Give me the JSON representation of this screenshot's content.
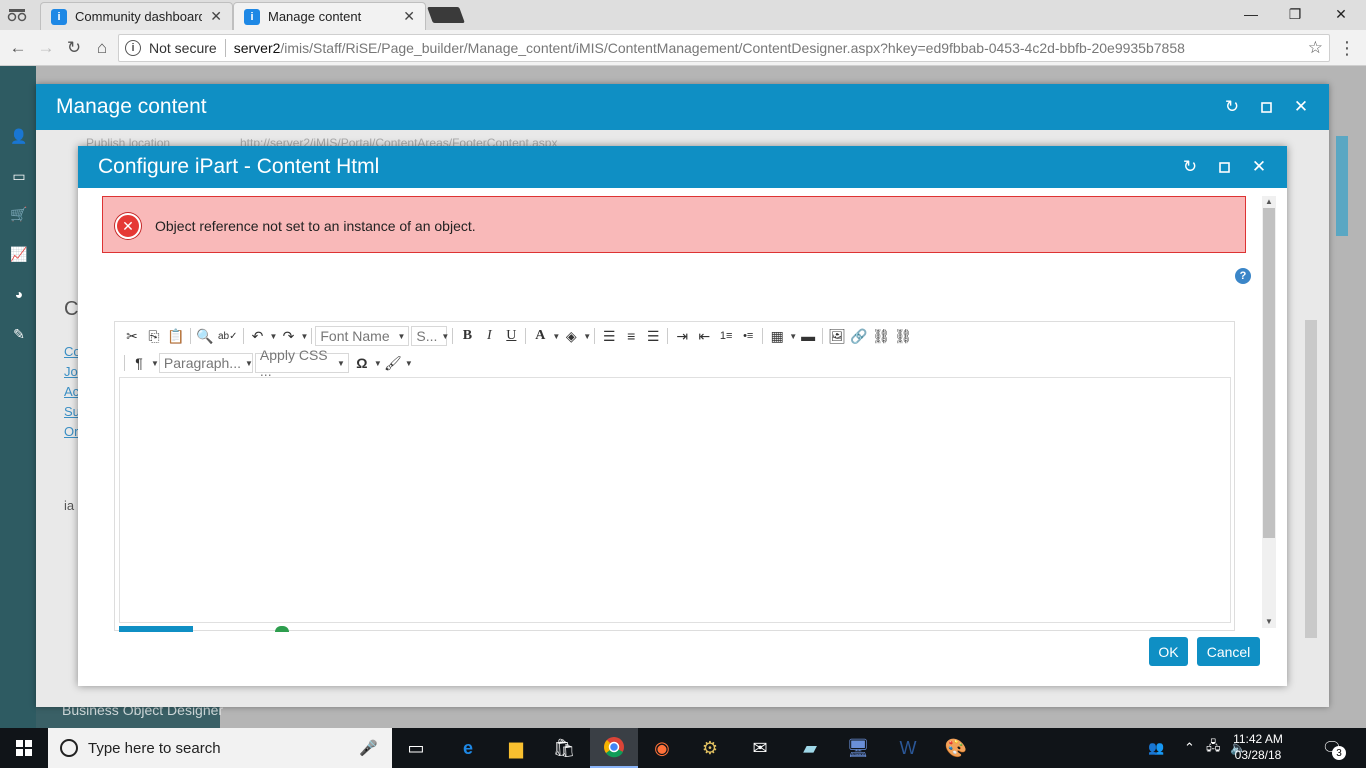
{
  "browser": {
    "tabs": [
      {
        "title": "Community dashboard",
        "active": false
      },
      {
        "title": "Manage content",
        "active": true
      }
    ],
    "address": {
      "security_label": "Not secure",
      "host": "server2",
      "path": "/imis/Staff/RiSE/Page_builder/Manage_content/iMIS/ContentManagement/ContentDesigner.aspx?hkey=ed9fbbab-0453-4c2d-bbfb-20e9935b7858"
    },
    "window_controls": {
      "minimize": "—",
      "maximize": "❐",
      "close": "✕"
    }
  },
  "background": {
    "publish_label": "Publish location",
    "publish_value": "http://server2/iMIS/Portal/ContentAreas/FooterContent.aspx",
    "side_letter": "C",
    "links": [
      "Co",
      "Jo",
      "Ac",
      "Su",
      "Or"
    ],
    "fragment": "ia",
    "bottom_text": "Business Object Designer"
  },
  "outer_modal": {
    "title": "Manage content"
  },
  "inner_modal": {
    "title": "Configure iPart - Content Html",
    "error_message": "Object reference not set to an instance of an object.",
    "help": "?",
    "ok_label": "OK",
    "cancel_label": "Cancel"
  },
  "editor": {
    "font_name": "Font Name",
    "font_size": "S...",
    "paragraph": "Paragraph...",
    "apply_css": "Apply CSS ...",
    "omega": "Ω",
    "bold": "B",
    "italic": "I",
    "underline": "U",
    "font_color": "A"
  },
  "taskbar": {
    "search_placeholder": "Type here to search",
    "time": "11:42 AM",
    "date": "03/28/18",
    "notification_count": "3"
  },
  "colors": {
    "header_blue": "#0f8fc4",
    "error_bg": "#f9b9b9",
    "error_border": "#dd3333"
  }
}
